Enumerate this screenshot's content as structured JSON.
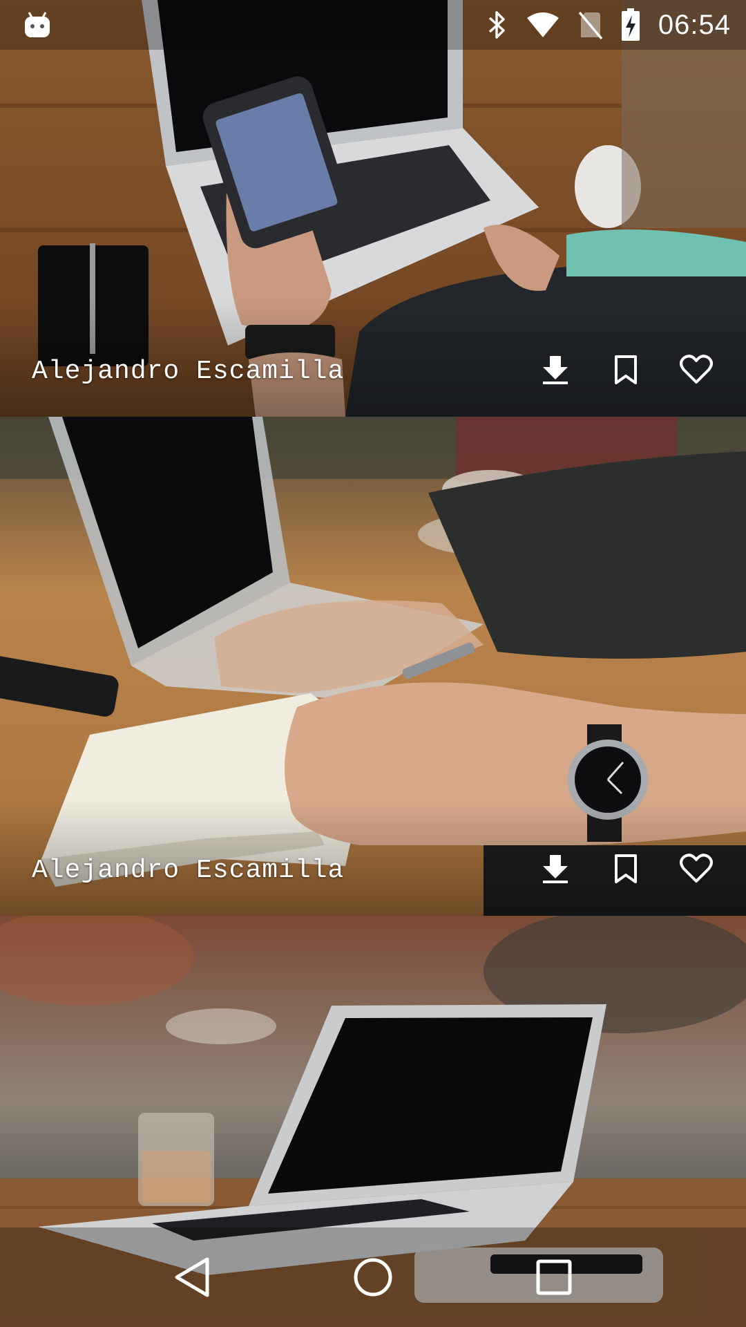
{
  "status_bar": {
    "time": "06:54",
    "icons": [
      "android-notification-icon",
      "bluetooth-icon",
      "wifi-icon",
      "no-sim-icon",
      "battery-charging-icon"
    ]
  },
  "photos": [
    {
      "author": "Alejandro Escamilla",
      "scene": "hand holding smartphone over laptop on wooden desk",
      "actions": [
        "download-icon",
        "bookmark-icon",
        "heart-icon"
      ]
    },
    {
      "author": "Alejandro Escamilla",
      "scene": "hand writing in notebook next to laptop",
      "actions": [
        "download-icon",
        "bookmark-icon",
        "heart-icon"
      ]
    },
    {
      "author": "",
      "scene": "open laptop on wooden table with glass",
      "actions": []
    }
  ],
  "nav_bar": {
    "buttons": [
      "back-icon",
      "home-icon",
      "recents-icon"
    ]
  },
  "colors": {
    "wood": "#a8723c",
    "wood_dark": "#6b4222",
    "overlay_text": "#ffffff"
  }
}
